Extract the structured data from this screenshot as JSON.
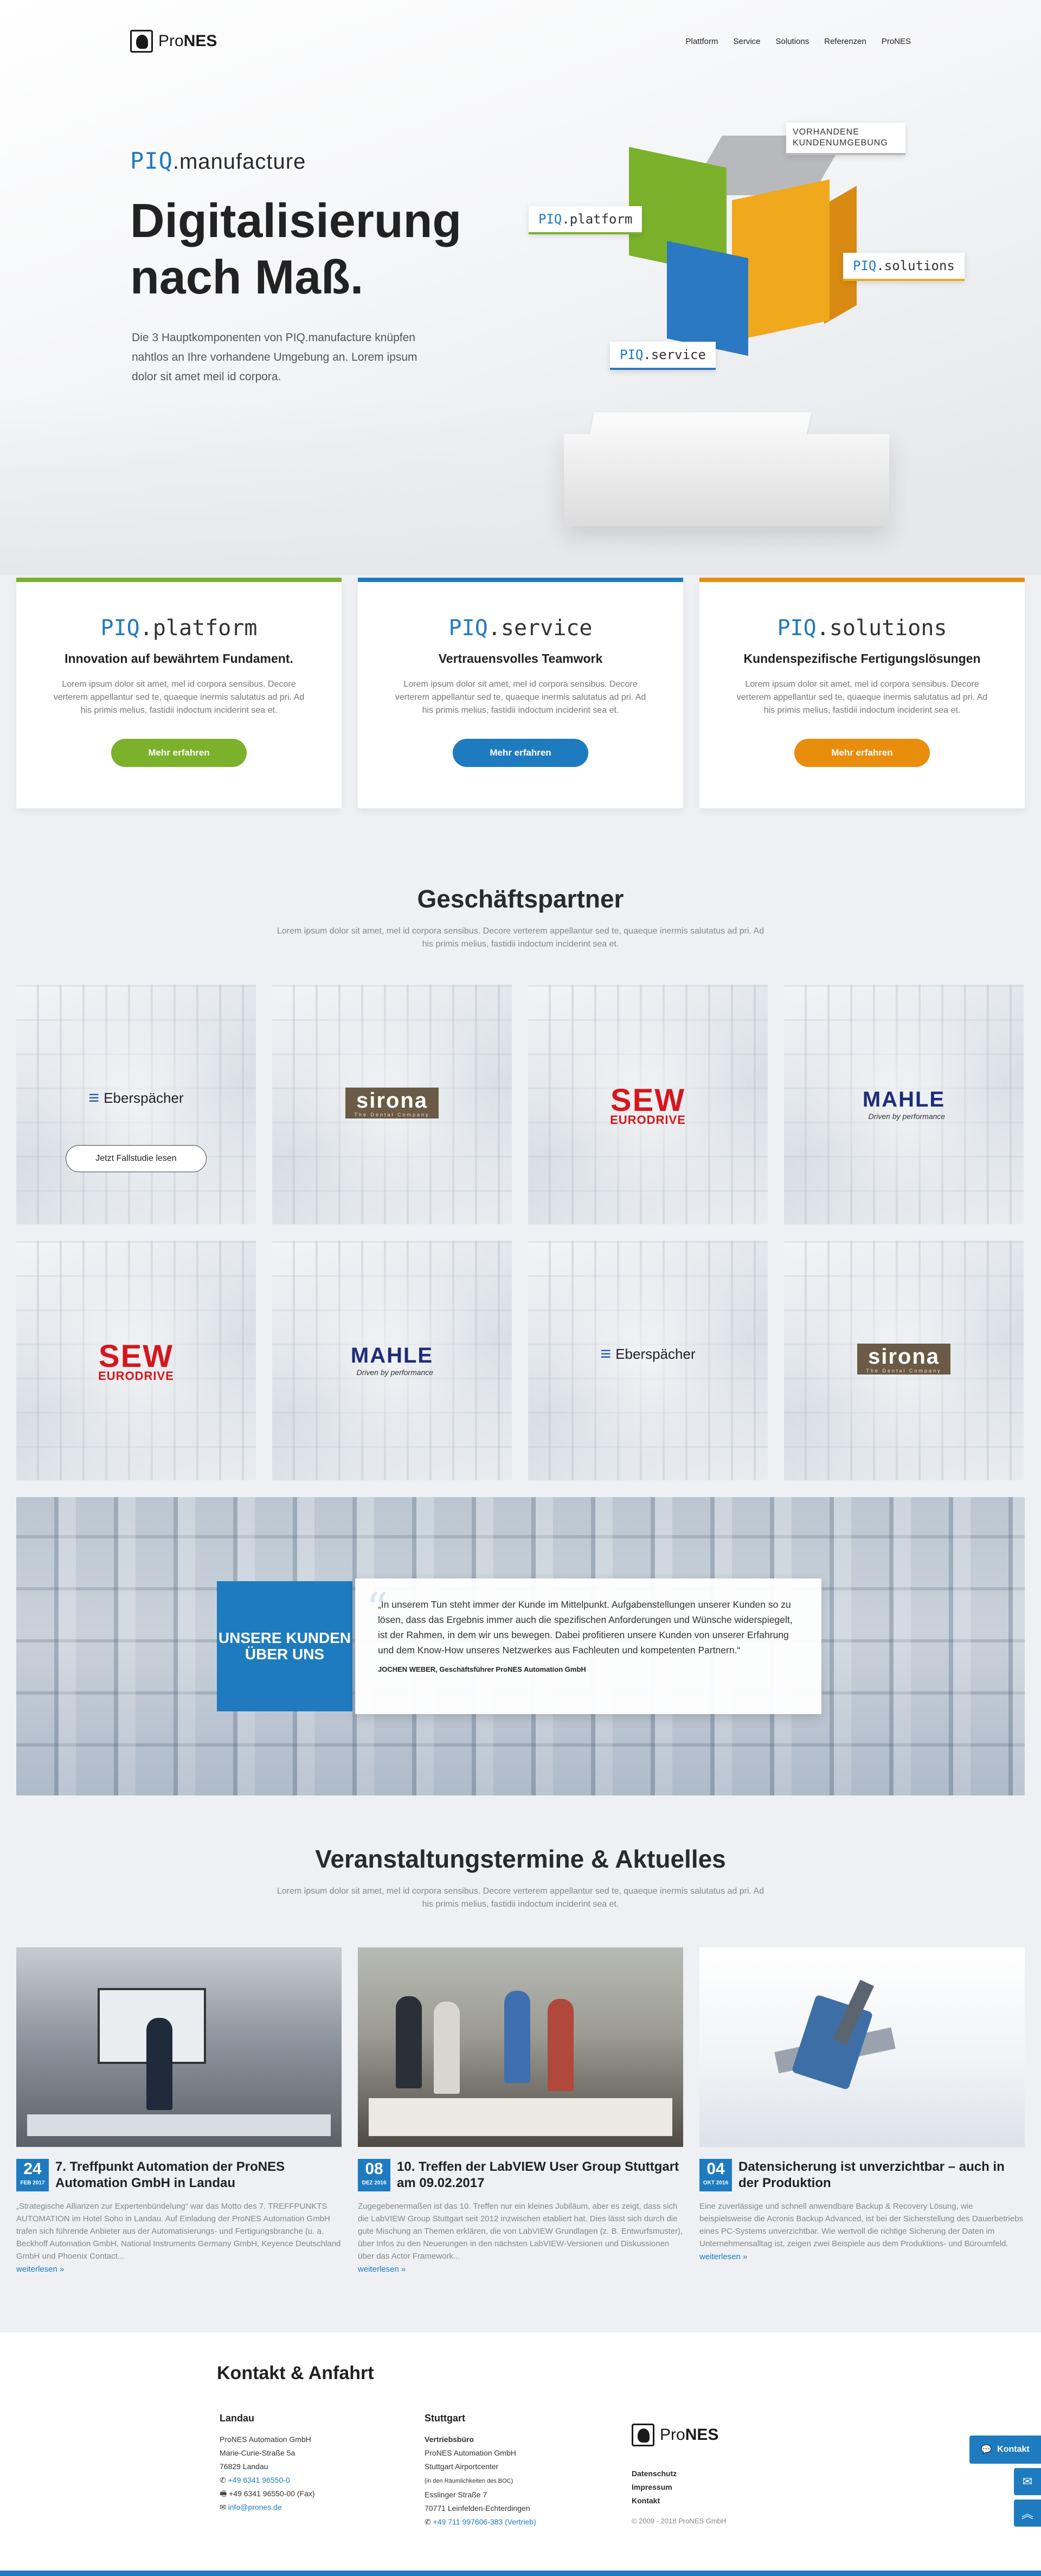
{
  "brand": {
    "name_light": "Pro",
    "name_bold": "NES"
  },
  "nav": [
    "Plattform",
    "Service",
    "Solutions",
    "Referenzen",
    "ProNES"
  ],
  "hero": {
    "sub_piq": "PIQ",
    "sub_rest": ".manufacture",
    "title": "Digitalisierung nach Maß.",
    "text": "Die 3 Hauptkomponenten von PIQ.manufacture knüpfen nahtlos an Ihre vorhandene Umgebung an. Lorem ipsum dolor sit amet meil id corpora.",
    "tag_umgebung": "VORHANDENE KUNDENUMGEBUNG",
    "tag_platform": ".platform",
    "tag_solutions": ".solutions",
    "tag_service": ".service",
    "piq": "PIQ"
  },
  "features": [
    {
      "piq": "PIQ",
      "name": ".platform",
      "headline": "Innovation auf bewährtem Fundament.",
      "text": "Lorem ipsum dolor sit amet, mel id corpora sensibus. Decore verterem appellantur sed te, quaeque inermis salutatus ad pri. Ad his primis melius, fastidii indoctum inciderint sea et.",
      "button": "Mehr erfahren"
    },
    {
      "piq": "PIQ",
      "name": ".service",
      "headline": "Vertrauensvolles Teamwork",
      "text": "Lorem ipsum dolor sit amet, mel id corpora sensibus. Decore verterem appellantur sed te, quaeque inermis salutatus ad pri. Ad his primis melius, fastidii indoctum inciderint sea et.",
      "button": "Mehr erfahren"
    },
    {
      "piq": "PIQ",
      "name": ".solutions",
      "headline": "Kundenspezifische Fertigungslösungen",
      "text": "Lorem ipsum dolor sit amet, mel id corpora sensibus. Decore verterem appellantur sed te, quaeque inermis salutatus ad pri. Ad his primis melius, fastidii indoctum inciderint sea et.",
      "button": "Mehr erfahren"
    }
  ],
  "partners": {
    "title": "Geschäftspartner",
    "subtitle": "Lorem ipsum dolor sit amet, mel id corpora sensibus. Decore verterem appellantur sed te, quaeque inermis salutatus ad pri. Ad his primis melius, fastidii indoctum inciderint sea et.",
    "case_button": "Jetzt Fallstudie lesen",
    "ebers": "Eberspächer",
    "sirona": "sirona",
    "sirona_tag": "The Dental Company",
    "sew": "SEW",
    "sew_sub": "EURODRIVE",
    "mahle": "MAHLE",
    "mahle_tag": "Driven by performance"
  },
  "testimonial": {
    "label": "UNSERE KUNDEN ÜBER UNS",
    "quote": "„In unserem Tun steht immer der Kunde im Mittelpunkt. Aufgabenstellungen unserer Kunden so zu lösen, dass das Ergebnis immer auch die spezifischen Anforderungen und Wünsche widerspiegelt, ist der Rahmen, in dem wir uns bewegen. Dabei profitieren unsere Kunden von unserer Erfahrung und dem Know-How unseres Netzwerkes aus Fachleuten und kompetenten Partnern.“",
    "author": "JOCHEN WEBER, Geschäftsführer ProNES Automation GmbH"
  },
  "news": {
    "title": "Veranstaltungstermine & Aktuelles",
    "subtitle": "Lorem ipsum dolor sit amet, mel id corpora sensibus. Decore verterem appellantur sed te, quaeque inermis salutatus ad pri. Ad his primis melius, fastidii indoctum inciderint sea et.",
    "more": "weiterlesen »",
    "items": [
      {
        "day": "24",
        "month": "FEB 2017",
        "title": "7. Treffpunkt Automation der ProNES Automation GmbH in Landau",
        "text": "„Strategische Allianzen zur Expertenbündelung“ war das Motto des 7. TREFFPUNKTS AUTOMATION im Hotel Soho in Landau. Auf Einladung der ProNES Automation GmbH trafen sich führende Anbieter aus der Automatisierungs- und Fertigungsbranche (u. a. Beckhoff Automation GmbH, National Instruments Germany GmbH, Keyence Deutschland GmbH und Phoenix Contact..."
      },
      {
        "day": "08",
        "month": "DEZ 2016",
        "title": "10. Treffen der LabVIEW User Group Stuttgart am 09.02.2017",
        "text": "Zugegebenermaßen ist das 10. Treffen nur ein kleines Jubiläum, aber es zeigt, dass sich die LabVIEW Group Stuttgart seit 2012 inzwischen etabliert hat. Dies lässt sich durch die gute Mischung an Themen erklären, die von LabVIEW Grundlagen (z. B. Entwurfsmuster), über Infos zu den Neuerungen in den nächsten LabVIEW-Versionen und Diskussionen über das Actor Framework..."
      },
      {
        "day": "04",
        "month": "OKT 2016",
        "title": "Datensicherung ist unverzichtbar – auch in der Produktion",
        "text": "Eine zuverlässige und schnell anwendbare Backup & Recovery Lösung, wie beispielsweise die Acronis Backup Advanced, ist bei der Sicherstellung des Dauerbetriebs eines PC-Systems unverzichtbar. Wie wertvoll die richtige Sicherung der Daten im Unternehmensalltag ist, zeigen zwei Beispiele aus dem Produktions- und Büroumfeld."
      }
    ]
  },
  "footer": {
    "title": "Kontakt & Anfahrt",
    "landau": {
      "heading": "Landau",
      "lines": [
        "ProNES Automation GmbH",
        "Marie-Curie-Straße 5a",
        "76829 Landau"
      ],
      "phone": "+49 6341 96550-0",
      "fax": "+49 6341 96550-00 (Fax)",
      "email": "info@prones.de"
    },
    "stuttgart": {
      "heading": "Stuttgart",
      "sub": "Vertriebsbüro",
      "lines": [
        "ProNES Automation GmbH",
        "Stuttgart Airportcenter"
      ],
      "small": "(in den Räumlichkeiten des BOC)",
      "lines2": [
        "Esslinger Straße 7",
        "70771 Leinfelden-Echterdingen"
      ],
      "phone": "+49 711 997606-383 (Vertrieb)"
    },
    "links": [
      "Datenschutz",
      "Impressum",
      "Kontakt"
    ],
    "copyright": "© 2009 - 2018 ProNES GmbH",
    "side_contact": "Kontakt"
  },
  "colors": {
    "accent_blue": "#1f7bc0",
    "green": "#7bb12b",
    "orange": "#e88d0c"
  }
}
